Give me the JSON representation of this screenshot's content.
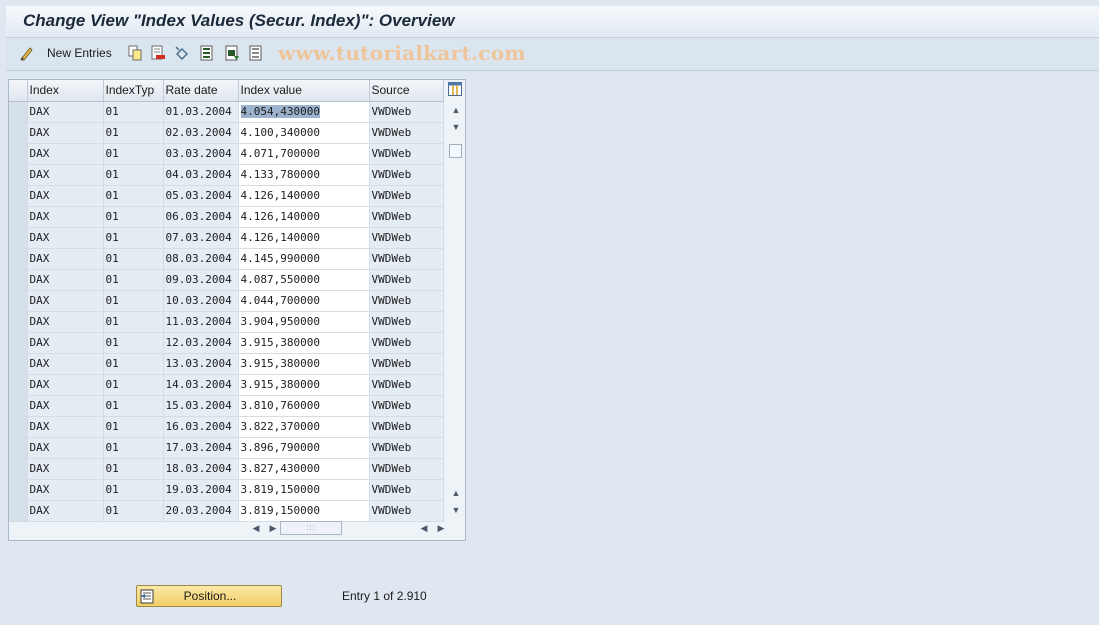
{
  "window": {
    "title": "Change View \"Index Values (Secur. Index)\": Overview"
  },
  "toolbar": {
    "new_entries_label": "New Entries",
    "watermark": "www.tutorialkart.com",
    "icons": [
      "display-change-icon",
      "copy-icon",
      "delete-icon",
      "undo-change-icon",
      "select-all-icon",
      "select-block-icon",
      "deselect-all-icon"
    ]
  },
  "table": {
    "headers": [
      "Index",
      "IndexTyp",
      "Rate date",
      "Index value",
      "Source"
    ],
    "rows": [
      [
        "DAX",
        "01",
        "01.03.2004",
        "4.054,430000",
        "VWDWeb"
      ],
      [
        "DAX",
        "01",
        "02.03.2004",
        "4.100,340000",
        "VWDWeb"
      ],
      [
        "DAX",
        "01",
        "03.03.2004",
        "4.071,700000",
        "VWDWeb"
      ],
      [
        "DAX",
        "01",
        "04.03.2004",
        "4.133,780000",
        "VWDWeb"
      ],
      [
        "DAX",
        "01",
        "05.03.2004",
        "4.126,140000",
        "VWDWeb"
      ],
      [
        "DAX",
        "01",
        "06.03.2004",
        "4.126,140000",
        "VWDWeb"
      ],
      [
        "DAX",
        "01",
        "07.03.2004",
        "4.126,140000",
        "VWDWeb"
      ],
      [
        "DAX",
        "01",
        "08.03.2004",
        "4.145,990000",
        "VWDWeb"
      ],
      [
        "DAX",
        "01",
        "09.03.2004",
        "4.087,550000",
        "VWDWeb"
      ],
      [
        "DAX",
        "01",
        "10.03.2004",
        "4.044,700000",
        "VWDWeb"
      ],
      [
        "DAX",
        "01",
        "11.03.2004",
        "3.904,950000",
        "VWDWeb"
      ],
      [
        "DAX",
        "01",
        "12.03.2004",
        "3.915,380000",
        "VWDWeb"
      ],
      [
        "DAX",
        "01",
        "13.03.2004",
        "3.915,380000",
        "VWDWeb"
      ],
      [
        "DAX",
        "01",
        "14.03.2004",
        "3.915,380000",
        "VWDWeb"
      ],
      [
        "DAX",
        "01",
        "15.03.2004",
        "3.810,760000",
        "VWDWeb"
      ],
      [
        "DAX",
        "01",
        "16.03.2004",
        "3.822,370000",
        "VWDWeb"
      ],
      [
        "DAX",
        "01",
        "17.03.2004",
        "3.896,790000",
        "VWDWeb"
      ],
      [
        "DAX",
        "01",
        "18.03.2004",
        "3.827,430000",
        "VWDWeb"
      ],
      [
        "DAX",
        "01",
        "19.03.2004",
        "3.819,150000",
        "VWDWeb"
      ],
      [
        "DAX",
        "01",
        "20.03.2004",
        "3.819,150000",
        "VWDWeb"
      ]
    ]
  },
  "position_button": {
    "label": "Position..."
  },
  "status": {
    "entry_text": "Entry 1 of 2.910"
  },
  "colors": {
    "accent": "#f1cf63",
    "background": "#dfe8f1",
    "highlight": "#9db3cd"
  }
}
